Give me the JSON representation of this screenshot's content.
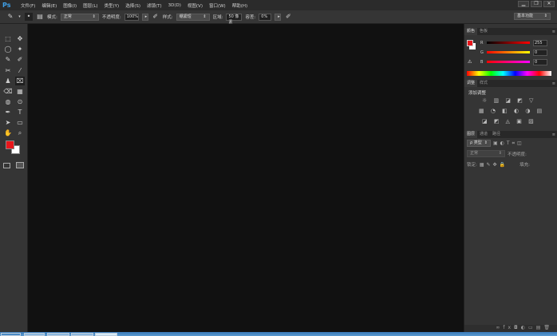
{
  "app": {
    "logo": "Ps",
    "menus": [
      "文件(F)",
      "编辑(E)",
      "图像(I)",
      "图层(L)",
      "类型(Y)",
      "选择(S)",
      "滤镜(T)",
      "3D(D)",
      "视图(V)",
      "窗口(W)",
      "帮助(H)"
    ],
    "window_buttons": [
      "▁",
      "❐",
      "✕"
    ]
  },
  "options": {
    "brush_size": "5",
    "mode_label": "模式:",
    "mode_value": "正常",
    "opacity_label": "不透明度:",
    "opacity_value": "100%",
    "style_label": "样式:",
    "style_value": "绷紧短",
    "area_label": "区域:",
    "area_value": "50 像素",
    "tolerance_label": "容差:",
    "tolerance_value": "0%",
    "workspace": "基本功能"
  },
  "panels": {
    "color": {
      "tabs": [
        "颜色",
        "色板"
      ],
      "channels": [
        {
          "label": "R",
          "value": "255"
        },
        {
          "label": "G",
          "value": "0"
        },
        {
          "label": "B",
          "value": "0"
        }
      ],
      "foreground": "#e8161b",
      "background": "#ffffff"
    },
    "adjustments": {
      "tabs": [
        "调整",
        "样式"
      ],
      "title": "添加调整",
      "rows": [
        "☼ ▥ ◪ ◩ ▽",
        "▦ ◔ ◧ ◐ ◑ ▤",
        "◪ ◩ ◬ ▣ ▨"
      ]
    },
    "layers": {
      "tabs": [
        "图层",
        "通道",
        "路径"
      ],
      "kind_label": "ρ 类型",
      "blend": "正常",
      "opacity_label": "不透明度:",
      "lock_label": "锁定:",
      "fill_label": "填充:"
    }
  },
  "tools": [
    "⬚",
    "✥",
    "◯",
    "✦",
    "✎",
    "✐",
    "✂",
    "⁄",
    "♟",
    "⌧",
    "⌫",
    "▦",
    "◍",
    "⊙",
    "✒",
    "T",
    "➤",
    "▭",
    "✋",
    "⌕"
  ]
}
